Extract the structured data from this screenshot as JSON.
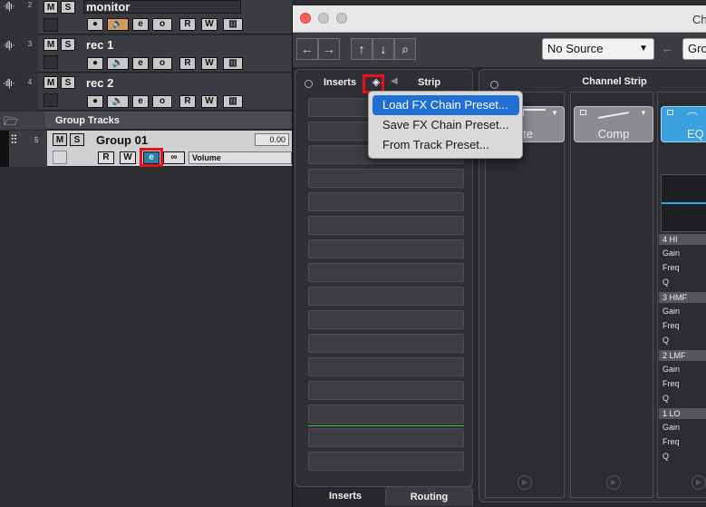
{
  "tracks": [
    {
      "number": "2",
      "name": "monitor",
      "mute": "M",
      "solo": "S"
    },
    {
      "number": "3",
      "name": "rec 1",
      "mute": "M",
      "solo": "S"
    },
    {
      "number": "4",
      "name": "rec 2",
      "mute": "M",
      "solo": "S"
    }
  ],
  "track_buttons": {
    "read": "R",
    "write": "W",
    "edit": "e",
    "monitor": "o",
    "record": "●",
    "link": "∞"
  },
  "group_folder": {
    "label": "Group Tracks"
  },
  "group_track": {
    "number": "5",
    "name": "Group 01",
    "mute": "M",
    "solo": "S",
    "volume_value": "0.00",
    "automation_param": "Volume"
  },
  "window": {
    "title": "Ch"
  },
  "toolbar": {
    "back": "←",
    "forward": "→",
    "up": "↑",
    "down": "↓",
    "search": "⌕",
    "source_select": "No Source",
    "target_partial": "Gro"
  },
  "left_panel": {
    "tab_inserts": "Inserts",
    "tab_strip": "Strip",
    "bottom_tab_inserts": "Inserts",
    "bottom_tab_routing": "Routing",
    "slot_count": 16
  },
  "channel_strip": {
    "title": "Channel Strip",
    "modules": [
      "ate",
      "Comp",
      "EQ"
    ]
  },
  "eq_bands": [
    {
      "name": "4 HI",
      "params": [
        "Gain",
        "Freq",
        "Q"
      ]
    },
    {
      "name": "3 HMF",
      "params": [
        "Gain",
        "Freq",
        "Q"
      ]
    },
    {
      "name": "2 LMF",
      "params": [
        "Gain",
        "Freq",
        "Q"
      ]
    },
    {
      "name": "1 LO",
      "params": [
        "Gain",
        "Freq",
        "Q"
      ]
    }
  ],
  "context_menu": {
    "items": [
      "Load FX Chain Preset...",
      "Save FX Chain Preset...",
      "From Track Preset..."
    ],
    "highlighted_index": 0
  },
  "colors": {
    "highlight": "#1f6fd6",
    "annotation_box": "#e2141c",
    "eq_active": "#3aa0de",
    "signal_line": "#3ec93e"
  }
}
